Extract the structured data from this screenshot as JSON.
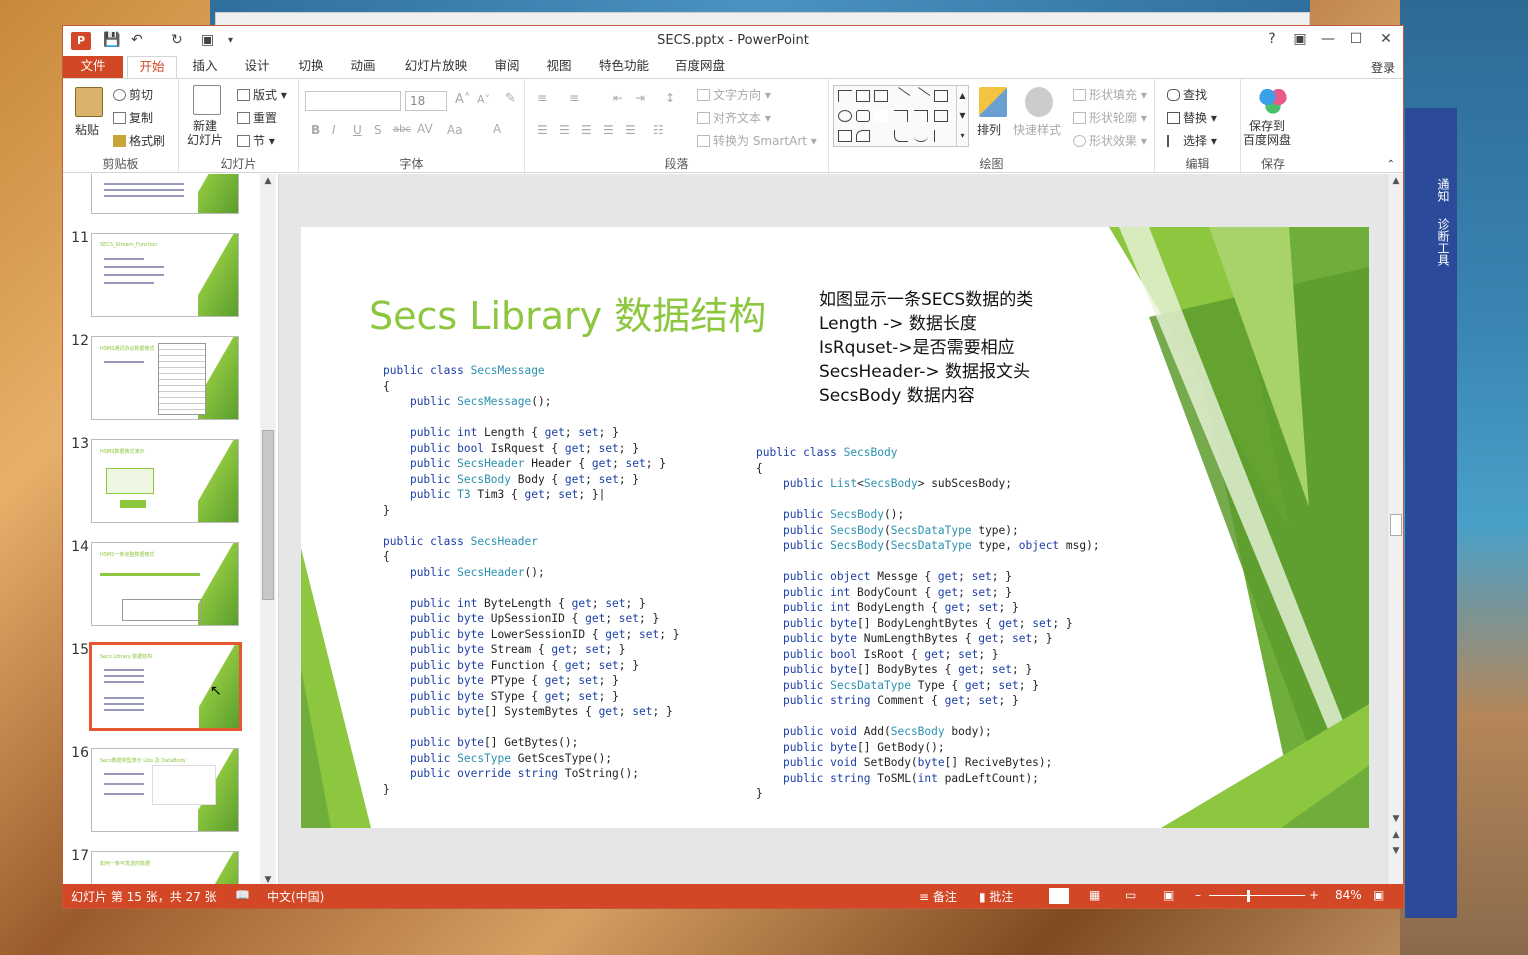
{
  "window": {
    "title": "SECS.pptx - PowerPoint",
    "login": "登录"
  },
  "qat_icons": [
    "save-icon",
    "undo-icon",
    "redo-icon",
    "presentation-icon"
  ],
  "tabs": [
    {
      "label": "文件"
    },
    {
      "label": "开始"
    },
    {
      "label": "插入"
    },
    {
      "label": "设计"
    },
    {
      "label": "切换"
    },
    {
      "label": "动画"
    },
    {
      "label": "幻灯片放映"
    },
    {
      "label": "审阅"
    },
    {
      "label": "视图"
    },
    {
      "label": "特色功能"
    },
    {
      "label": "百度网盘"
    }
  ],
  "ribbon": {
    "clipboard": {
      "label": "剪贴板",
      "paste": "粘贴",
      "cut": "剪切",
      "copy": "复制",
      "format_painter": "格式刷"
    },
    "slides": {
      "label": "幻灯片",
      "new_slide": "新建\n幻灯片",
      "layout": "版式",
      "reset": "重置",
      "section": "节"
    },
    "font": {
      "label": "字体",
      "size": "18"
    },
    "paragraph": {
      "label": "段落",
      "text_direction": "文字方向",
      "align_text": "对齐文本",
      "smartart": "转换为 SmartArt"
    },
    "drawing": {
      "label": "绘图",
      "arrange": "排列",
      "quick_styles": "快速样式",
      "shape_fill": "形状填充",
      "shape_outline": "形状轮廓",
      "shape_effects": "形状效果"
    },
    "editing": {
      "label": "编辑",
      "find": "查找",
      "replace": "替换",
      "select": "选择"
    },
    "save": {
      "label": "保存",
      "save_to_baidu": "保存到\n百度网盘"
    }
  },
  "thumbnails": [
    {
      "num": "11",
      "title": "SECS_Stream_Function"
    },
    {
      "num": "12",
      "title": "HSMS通讯协议数据格式"
    },
    {
      "num": "13",
      "title": "HSMS数据格式演示"
    },
    {
      "num": "14",
      "title": "HSMS一条完整数据格式"
    },
    {
      "num": "15",
      "title": "Secs Library 数据结构"
    },
    {
      "num": "16",
      "title": "Secs数据类型表示 Libs 及 DataBody"
    },
    {
      "num": "17",
      "title": "如何一条可发送的数据"
    }
  ],
  "slide": {
    "title": "Secs Library 数据结构",
    "notes": [
      "如图显示一条SECS数据的类",
      "Length -> 数据长度",
      "IsRquset->是否需要相应",
      "SecsHeader-> 数据报文头",
      "SecsBody  数据内容"
    ]
  },
  "status": {
    "slide_info": "幻灯片 第 15 张，共 27 张",
    "language": "中文(中国)",
    "notes": "备注",
    "comments": "批注",
    "zoom": "84%"
  },
  "side_pane": {
    "notify": "通知",
    "diag": "诊断工具"
  },
  "colors": {
    "accent": "#d24726",
    "green": "#8dc63f",
    "keyword": "#1a3fa6",
    "type": "#2b91af"
  }
}
